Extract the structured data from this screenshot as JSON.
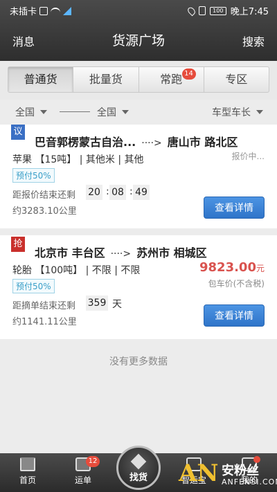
{
  "status_bar": {
    "carrier": "未插卡",
    "battery": "100",
    "time": "晚上7:45"
  },
  "header": {
    "left": "消息",
    "title": "货源广场",
    "right": "搜索"
  },
  "tabs": [
    {
      "label": "普通货",
      "active": true
    },
    {
      "label": "批量货"
    },
    {
      "label": "常跑",
      "badge": "14"
    },
    {
      "label": "专区"
    }
  ],
  "filter": {
    "from": "全国",
    "to": "全国",
    "vehicle": "车型车长"
  },
  "cards": [
    {
      "tag": "议",
      "from": "巴音郭楞蒙古自治...",
      "arrow": "····>",
      "to": "唐山市 路北区",
      "goods": "苹果 【15吨】 | 其他米 | 其他",
      "quote": "报价中...",
      "pay": "预付50%",
      "countdown_label": "距报价结束还剩",
      "hh": "20",
      "mm": "08",
      "ss": "49",
      "distance": "约3283.10公里",
      "button": "查看详情"
    },
    {
      "tag": "抢",
      "from": "北京市 丰台区",
      "arrow": "····>",
      "to": "苏州市 相城区",
      "goods": "轮胎 【100吨】 | 不限 | 不限",
      "price": "9823.00",
      "price_unit": "元",
      "price_type": "包车价(不含税)",
      "pay": "预付50%",
      "countdown_label": "距摘单结束还剩",
      "days": "359",
      "days_unit": "天",
      "distance": "约1141.11公里",
      "button": "查看详情"
    }
  ],
  "no_more": "没有更多数据",
  "bottom_nav": {
    "home": "首页",
    "orders": "运单",
    "orders_badge": "12",
    "find": "找货",
    "wallet": "智运宝",
    "mine": "我的"
  },
  "watermark": {
    "logo": "AN",
    "cn": "安粉丝",
    "en": "ANFENSI.COM"
  },
  "colors": {
    "accent_blue": "#2f74c9",
    "price_red": "#d9534f",
    "badge_red": "#e64c3c"
  }
}
